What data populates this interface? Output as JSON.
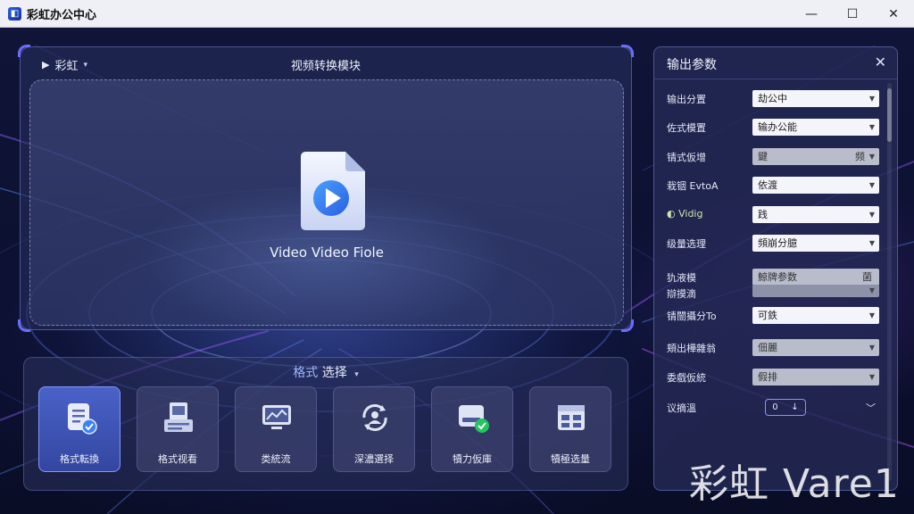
{
  "app": {
    "title": "彩虹办公中心"
  },
  "window_controls": {
    "minimize": "—",
    "maximize": "☐",
    "close": "✕"
  },
  "main_panel": {
    "mode_label": "彩虹",
    "title": "视频转换模块",
    "drop_text": "Video Video Fiole"
  },
  "format_panel": {
    "title_accent": "格式",
    "title_rest": "选择",
    "buttons": [
      {
        "label": "格式転換",
        "icon": "document-check-icon",
        "active": true
      },
      {
        "label": "格式视看",
        "icon": "film-doc-icon",
        "active": false
      },
      {
        "label": "类統流",
        "icon": "monitor-chart-icon",
        "active": false
      },
      {
        "label": "深濃選择",
        "icon": "refresh-user-icon",
        "active": false
      },
      {
        "label": "犢力仮庫",
        "icon": "drive-check-icon",
        "active": false
      },
      {
        "label": "犢極选量",
        "icon": "calendar-grid-icon",
        "active": false
      }
    ]
  },
  "settings": {
    "title": "输出参数",
    "rows": [
      {
        "label": "输出分置",
        "value": "劫公中",
        "aux": "",
        "dim": false
      },
      {
        "label": "佐式模置",
        "value": "输办公能",
        "aux": "",
        "dim": false
      },
      {
        "label": "锖式仮增",
        "value": "鍵",
        "aux": "频",
        "dim": true
      },
      {
        "label": "栽铟 EvtoA",
        "value": "依渡",
        "aux": "",
        "dim": false
      },
      {
        "label": "Vidig",
        "value": "践",
        "aux": "",
        "dim": false
      },
      {
        "label": "级量选理",
        "value": "頻崩分臆",
        "aux": "",
        "dim": false
      },
      {
        "label": "犰液模",
        "value": "鯨牌参数",
        "aux": "菌",
        "dim": true
      },
      {
        "label": "辯摸滴",
        "value": "",
        "aux": "",
        "dim": true
      },
      {
        "label": "锖闓攝分To",
        "value": "可鉄",
        "aux": "",
        "dim": false
      },
      {
        "label": "頬出樺雜翁",
        "value": "佃麗",
        "aux": "",
        "dim": true
      },
      {
        "label": "委戲仮統",
        "value": "假排",
        "aux": "",
        "dim": true
      }
    ],
    "last_row": {
      "label": "议摘溫",
      "stepper_left": "0",
      "stepper_right": "↓"
    }
  },
  "watermark": "彩虹 Vare1"
}
